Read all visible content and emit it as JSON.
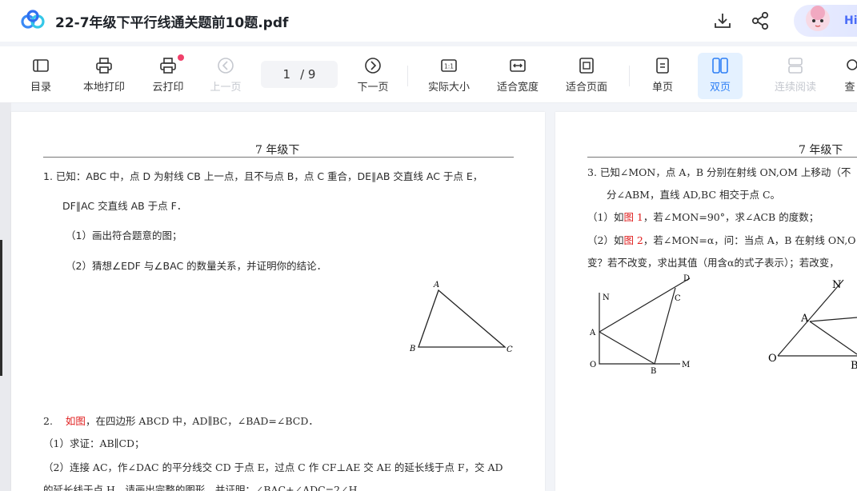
{
  "header": {
    "title": "22-7年级下平行线通关题前10题.pdf",
    "assistant_label": "Hi"
  },
  "toolbar": {
    "items": [
      {
        "label": "目录",
        "icon": "toc-icon"
      },
      {
        "label": "本地打印",
        "icon": "printer-icon"
      },
      {
        "label": "云打印",
        "icon": "cloud-printer-icon"
      },
      {
        "label": "上一页",
        "icon": "prev-page-icon"
      },
      {
        "label": "下一页",
        "icon": "next-page-icon"
      },
      {
        "label": "实际大小",
        "icon": "actual-size-icon"
      },
      {
        "label": "适合宽度",
        "icon": "fit-width-icon"
      },
      {
        "label": "适合页面",
        "icon": "fit-page-icon"
      },
      {
        "label": "单页",
        "icon": "single-page-icon"
      },
      {
        "label": "双页",
        "icon": "double-page-icon"
      },
      {
        "label": "连续阅读",
        "icon": "continuous-read-icon"
      },
      {
        "label": "查",
        "icon": "search-icon"
      }
    ],
    "page_current": "1",
    "page_total": "/ 9",
    "actual_size_glyph": "1:1"
  },
  "page_left": {
    "header": "7 年级下",
    "q1": {
      "line1": "1.   已知：ABC 中，点 D 为射线 CB 上一点，且不与点 B，点 C 重合，DE∥AB 交直线 AC 于点 E，",
      "line2": "DF∥AC 交直线 AB 于点 F．",
      "line3": "（1）画出符合题意的图；",
      "line4": "（2）猜想∠EDF 与∠BAC 的数量关系，并证明你的结论．",
      "fig_labels": {
        "a": "A",
        "b": "B",
        "c": "C"
      }
    },
    "q2": {
      "num": "2.",
      "red": "如图",
      "rest": "，在四边形 ABCD 中，AD∥BC，∠BAD=∠BCD．",
      "line2": "（1）求证：AB∥CD；",
      "line3": "（2）连接 AC，作∠DAC 的平分线交 CD 于点 E，过点 C 作 CF⊥AE 交 AE 的延长线于点 F，交 AD",
      "line4": "的延长线于点 H，请画出完整的图形，并证明：∠BAC+∠ADC=2∠H．"
    }
  },
  "page_right": {
    "header": "7 年级下",
    "q3": {
      "line1": "3.   已知∠MON，点 A，B 分别在射线 ON,OM 上移动（不",
      "line2": "分∠ABM，直线 AD,BC 相交于点 C。",
      "line3_pre": "（1）如",
      "line3_red": "图 1",
      "line3_post": "，若∠MON=90°，求∠ACB 的度数；",
      "line4_pre": "（2）如",
      "line4_red": "图 2",
      "line4_post": "，若∠MON=α，问：当点 A，B 在射线 ON,O",
      "line5": "变？若不改变，求出其值（用含α的式子表示）；若改变，",
      "fig1": {
        "n": "N",
        "a": "A",
        "o": "O",
        "b": "B",
        "m": "M",
        "c": "C",
        "d": "D"
      },
      "fig2": {
        "n": "N",
        "a": "A",
        "o": "O",
        "b": "B"
      }
    }
  }
}
